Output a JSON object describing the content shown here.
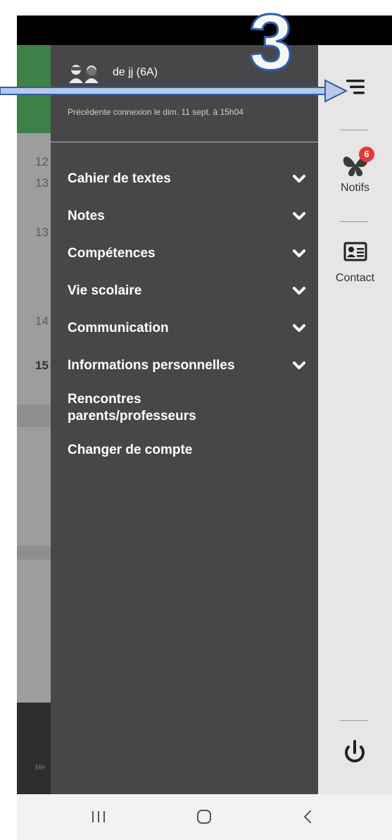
{
  "annotation": {
    "number": "3"
  },
  "drawer": {
    "user_name": "de jj (6A)",
    "last_login": "Précédente connexion le dim. 11 sept. à 15h04",
    "menu": [
      {
        "label": "Cahier de textes",
        "expandable": true
      },
      {
        "label": "Notes",
        "expandable": true
      },
      {
        "label": "Compétences",
        "expandable": true
      },
      {
        "label": "Vie scolaire",
        "expandable": true
      },
      {
        "label": "Communication",
        "expandable": true
      },
      {
        "label": "Informations personnelles",
        "expandable": true
      },
      {
        "label": "Rencontres parents/professeurs",
        "expandable": false
      },
      {
        "label": "Changer de compte",
        "expandable": false
      }
    ]
  },
  "rail": {
    "notifs_label": "Notifs",
    "notifs_count": "6",
    "contact_label": "Contact"
  },
  "background": {
    "numbers": [
      "12",
      "13",
      "13",
      "14",
      "15"
    ],
    "footer_text": "Me"
  },
  "colors": {
    "drawer_bg": "#47474a",
    "rail_bg": "#e6e6e6",
    "badge": "#e53935",
    "annotation_blue": "#2e5fa8"
  },
  "icons": [
    "avatar-icon",
    "chevron-down-icon",
    "menu-icon",
    "butterfly-icon",
    "contact-card-icon",
    "power-icon",
    "recent-apps-icon",
    "home-icon",
    "back-icon"
  ]
}
